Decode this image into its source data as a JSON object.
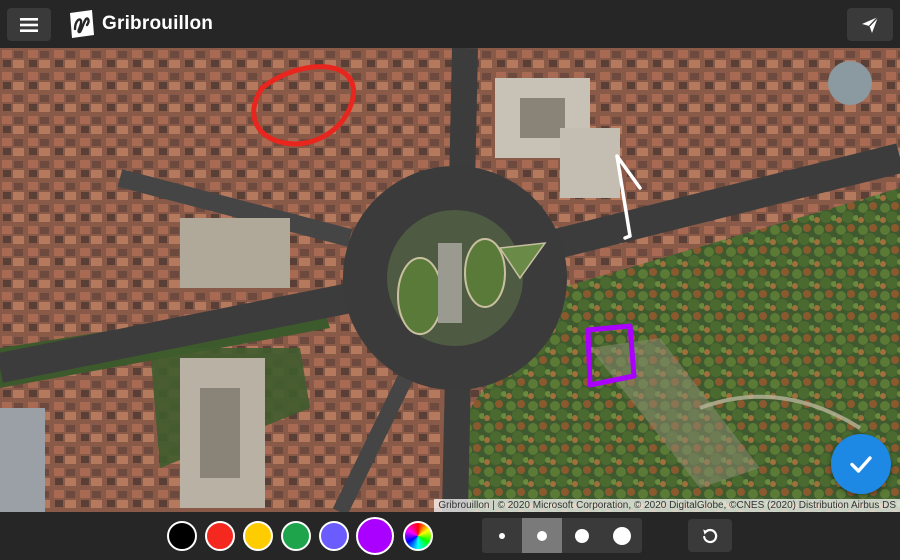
{
  "app": {
    "title": "Gribrouillon"
  },
  "map": {
    "attribution": "Gribrouillon | © 2020 Microsoft Corporation, © 2020 DigitalGlobe, ©CNES (2020) Distribution Airbus DS"
  },
  "palette": {
    "colors": [
      {
        "name": "black",
        "hex": "#000000"
      },
      {
        "name": "red",
        "hex": "#f4281e"
      },
      {
        "name": "yellow",
        "hex": "#ffcc00"
      },
      {
        "name": "green",
        "hex": "#1ea54b"
      },
      {
        "name": "blue",
        "hex": "#6a5cff"
      },
      {
        "name": "purple",
        "hex": "#aa00ff",
        "selected": true
      },
      {
        "name": "rainbow",
        "hex": "conic"
      }
    ]
  },
  "brush_sizes": {
    "options": [
      "xs",
      "s",
      "m",
      "l"
    ],
    "selected": "s"
  },
  "icons": {
    "menu": "menu-icon",
    "send": "send-icon",
    "confirm": "check-icon",
    "undo": "undo-icon"
  }
}
